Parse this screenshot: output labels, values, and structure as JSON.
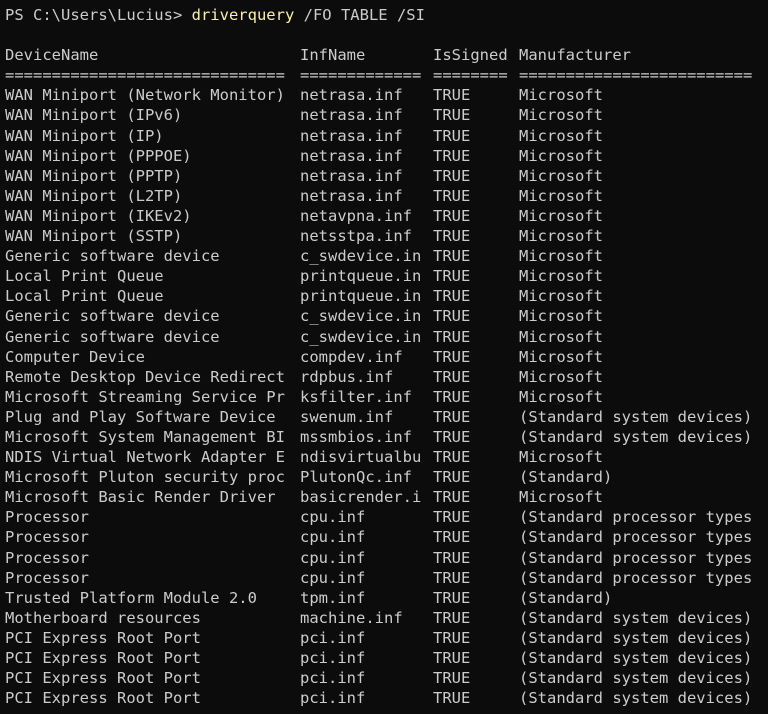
{
  "prompt": {
    "path": "PS C:\\Users\\Lucius> ",
    "command": "driverquery",
    "args": " /FO TABLE /SI"
  },
  "table": {
    "headers": [
      "DeviceName",
      "InfName",
      "IsSigned",
      "Manufacturer"
    ],
    "separators": [
      "==============================",
      "=============",
      "========",
      "========================="
    ],
    "rows": [
      [
        "WAN Miniport (Network Monitor)",
        "netrasa.inf",
        "TRUE",
        "Microsoft"
      ],
      [
        "WAN Miniport (IPv6)",
        "netrasa.inf",
        "TRUE",
        "Microsoft"
      ],
      [
        "WAN Miniport (IP)",
        "netrasa.inf",
        "TRUE",
        "Microsoft"
      ],
      [
        "WAN Miniport (PPPOE)",
        "netrasa.inf",
        "TRUE",
        "Microsoft"
      ],
      [
        "WAN Miniport (PPTP)",
        "netrasa.inf",
        "TRUE",
        "Microsoft"
      ],
      [
        "WAN Miniport (L2TP)",
        "netrasa.inf",
        "TRUE",
        "Microsoft"
      ],
      [
        "WAN Miniport (IKEv2)",
        "netavpna.inf",
        "TRUE",
        "Microsoft"
      ],
      [
        "WAN Miniport (SSTP)",
        "netsstpa.inf",
        "TRUE",
        "Microsoft"
      ],
      [
        "Generic software device",
        "c_swdevice.in",
        "TRUE",
        "Microsoft"
      ],
      [
        "Local Print Queue",
        "printqueue.in",
        "TRUE",
        "Microsoft"
      ],
      [
        "Local Print Queue",
        "printqueue.in",
        "TRUE",
        "Microsoft"
      ],
      [
        "Generic software device",
        "c_swdevice.in",
        "TRUE",
        "Microsoft"
      ],
      [
        "Generic software device",
        "c_swdevice.in",
        "TRUE",
        "Microsoft"
      ],
      [
        "Computer Device",
        "compdev.inf",
        "TRUE",
        "Microsoft"
      ],
      [
        "Remote Desktop Device Redirect",
        "rdpbus.inf",
        "TRUE",
        "Microsoft"
      ],
      [
        "Microsoft Streaming Service Pr",
        "ksfilter.inf",
        "TRUE",
        "Microsoft"
      ],
      [
        "Plug and Play Software Device",
        "swenum.inf",
        "TRUE",
        "(Standard system devices)"
      ],
      [
        "Microsoft System Management BI",
        "mssmbios.inf",
        "TRUE",
        "(Standard system devices)"
      ],
      [
        "NDIS Virtual Network Adapter E",
        "ndisvirtualbu",
        "TRUE",
        "Microsoft"
      ],
      [
        "Microsoft Pluton security proc",
        "PlutonQc.inf",
        "TRUE",
        "(Standard)"
      ],
      [
        "Microsoft Basic Render Driver",
        "basicrender.i",
        "TRUE",
        "Microsoft"
      ],
      [
        "Processor",
        "cpu.inf",
        "TRUE",
        "(Standard processor types"
      ],
      [
        "Processor",
        "cpu.inf",
        "TRUE",
        "(Standard processor types"
      ],
      [
        "Processor",
        "cpu.inf",
        "TRUE",
        "(Standard processor types"
      ],
      [
        "Processor",
        "cpu.inf",
        "TRUE",
        "(Standard processor types"
      ],
      [
        "Trusted Platform Module 2.0",
        "tpm.inf",
        "TRUE",
        "(Standard)"
      ],
      [
        "Motherboard resources",
        "machine.inf",
        "TRUE",
        "(Standard system devices)"
      ],
      [
        "PCI Express Root Port",
        "pci.inf",
        "TRUE",
        "(Standard system devices)"
      ],
      [
        "PCI Express Root Port",
        "pci.inf",
        "TRUE",
        "(Standard system devices)"
      ],
      [
        "PCI Express Root Port",
        "pci.inf",
        "TRUE",
        "(Standard system devices)"
      ],
      [
        "PCI Express Root Port",
        "pci.inf",
        "TRUE",
        "(Standard system devices)"
      ]
    ]
  },
  "colors": {
    "background": "#0c0c0c",
    "foreground": "#cccccc",
    "command": "#f9f1a5"
  }
}
